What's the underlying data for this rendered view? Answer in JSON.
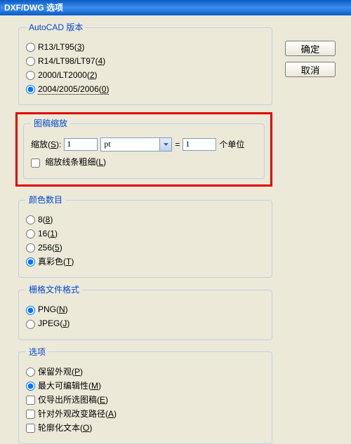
{
  "title": "DXF/DWG 选项",
  "buttons": {
    "ok": "确定",
    "cancel": "取消"
  },
  "autocad": {
    "legend": "AutoCAD 版本",
    "opts": [
      {
        "label": "R13/LT95(",
        "u": "3",
        "tail": ")",
        "sel": false
      },
      {
        "label": "R14/LT98/LT97(",
        "u": "4",
        "tail": ")",
        "sel": false
      },
      {
        "label": "2000/LT2000(",
        "u": "2",
        "tail": ")",
        "sel": false
      },
      {
        "label": "2004/2005/2006(",
        "u": "0",
        "tail": ")",
        "sel": true
      }
    ]
  },
  "scale": {
    "legend": "图稿缩放",
    "label_pre": "缩放(",
    "label_u": "S",
    "label_post": "):",
    "value": "1",
    "unit": "pt",
    "eq": "=",
    "value2": "1",
    "unit_text": "个单位",
    "cb_pre": "缩放线条粗细(",
    "cb_u": "L",
    "cb_post": ")",
    "cb_checked": false
  },
  "colors": {
    "legend": "颜色数目",
    "opts": [
      {
        "label": "8(",
        "u": "8",
        "tail": ")",
        "sel": false
      },
      {
        "label": "16(",
        "u": "1",
        "tail": ")",
        "sel": false
      },
      {
        "label": "256(",
        "u": "5",
        "tail": ")",
        "sel": false
      },
      {
        "label": "真彩色(",
        "u": "T",
        "tail": ")",
        "sel": true
      }
    ]
  },
  "raster": {
    "legend": "栅格文件格式",
    "opts": [
      {
        "label": "PNG(",
        "u": "N",
        "tail": ")",
        "sel": true
      },
      {
        "label": "JPEG(",
        "u": "J",
        "tail": ")",
        "sel": false
      }
    ]
  },
  "options": {
    "legend": "选项",
    "radios": [
      {
        "label": "保留外观(",
        "u": "P",
        "tail": ")",
        "sel": false
      },
      {
        "label": "最大可编辑性(",
        "u": "M",
        "tail": ")",
        "sel": true
      }
    ],
    "checks": [
      {
        "label": "仅导出所选图稿(",
        "u": "E",
        "tail": ")",
        "checked": false
      },
      {
        "label": "针对外观改变路径(",
        "u": "A",
        "tail": ")",
        "checked": false
      },
      {
        "label": "轮廓化文本(",
        "u": "O",
        "tail": ")",
        "checked": false
      }
    ]
  }
}
